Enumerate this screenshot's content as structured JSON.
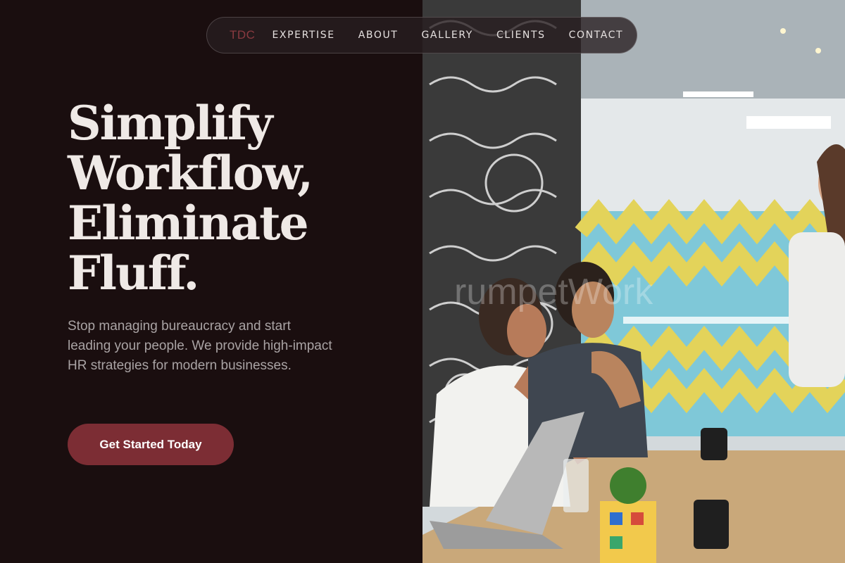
{
  "nav": {
    "logo": "TDC",
    "links": [
      "EXPERTISE",
      "ABOUT",
      "GALLERY",
      "CLIENTS",
      "CONTACT"
    ]
  },
  "hero": {
    "headline_lines": [
      "Simplify",
      "Workflow,",
      "Eliminate",
      "Fluff."
    ],
    "subtext": "Stop managing bureaucracy and start leading your people. We provide high-impact HR strategies for modern businesses.",
    "cta_label": "Get Started Today"
  },
  "colors": {
    "background": "#1a0e0f",
    "accent": "#7c2d34",
    "logo": "#8a3a40",
    "headline": "#efe9e6",
    "subtext": "#a9a3a4"
  }
}
